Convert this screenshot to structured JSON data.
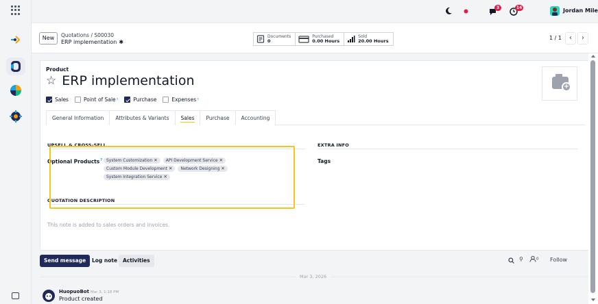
{
  "colors": {
    "brand_primary": "#1f2a5a",
    "highlight_yellow": "#f5c518",
    "badge_red": "#e11d48",
    "tag_bg": "#e5e7eb"
  },
  "topbar": {
    "user_name": "Jordan Miles",
    "messages_badge": "3",
    "activity_badge": "14",
    "icons": [
      "moon-icon",
      "status-dot-icon",
      "chat-icon",
      "clock-icon"
    ]
  },
  "control": {
    "new_label": "New",
    "breadcrumb_parent": "Quotations",
    "breadcrumb_sep": "/",
    "breadcrumb_current": "S00030",
    "record_name": "ERP implementation",
    "smart_buttons": [
      {
        "label": "Documents",
        "value": "0",
        "icon": "document-icon"
      },
      {
        "label": "Purchased",
        "value": "0.00 Hours",
        "icon": "credit-card-icon"
      },
      {
        "label": "Sold",
        "value": "20.00 Hours",
        "icon": "bar-chart-icon"
      }
    ],
    "pager": "1 / 1"
  },
  "form": {
    "product_label": "Product",
    "title": "ERP implementation",
    "checkboxes": [
      {
        "label": "Sales",
        "checked": true,
        "help": false
      },
      {
        "label": "Point of Sale",
        "checked": false,
        "help": true
      },
      {
        "label": "Purchase",
        "checked": true,
        "help": false
      },
      {
        "label": "Expenses",
        "checked": false,
        "help": true
      }
    ],
    "help_mark": "?",
    "tabs": [
      "General Information",
      "Attributes & Variants",
      "Sales",
      "Purchase",
      "Accounting"
    ],
    "active_tab": "Sales",
    "upsell_heading": "UPSELL & CROSS-SELL",
    "optional_products_label": "Optional Products",
    "optional_products": [
      "System Customization",
      "API Development Service",
      "Custom Module Development",
      "Network Designing",
      "System Integration Service"
    ],
    "extra_info_heading": "EXTRA INFO",
    "tags_label": "Tags",
    "quotation_heading": "QUOTATION DESCRIPTION",
    "quotation_placeholder": "This note is added to sales orders and invoices."
  },
  "chatter": {
    "send_message": "Send message",
    "log_note": "Log note",
    "activities": "Activities",
    "followers_count": "0",
    "follow_label": "Follow",
    "date_divider": "Mar 3, 2026",
    "message_author": "HuopuoBot",
    "message_time": "Mar 3, 1:18 PM",
    "message_body": "Product created"
  }
}
